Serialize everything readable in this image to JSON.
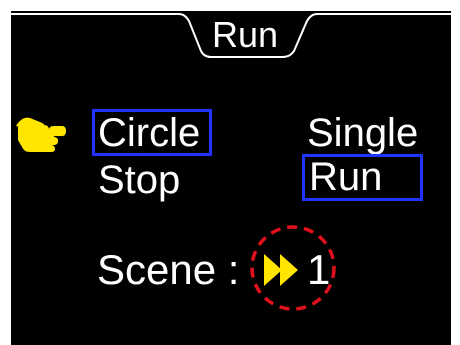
{
  "header": {
    "title": "Run"
  },
  "menu": {
    "left": [
      "Circle",
      "Stop"
    ],
    "right": [
      "Single",
      "Run"
    ]
  },
  "selection": {
    "left": "Circle",
    "right": "Run"
  },
  "scene": {
    "label": "Scene :",
    "value": "1",
    "icon": "fast-forward-icon"
  },
  "icons": {
    "pointer": "hand-pointer-icon",
    "emphasis": "dashed-circle-highlight"
  },
  "colors": {
    "background": "#000000",
    "text": "#ffffff",
    "selection_box": "#1f35ff",
    "pointer": "#ffe500",
    "fast_forward": "#ffe500",
    "highlight_circle": "#e0101d"
  }
}
